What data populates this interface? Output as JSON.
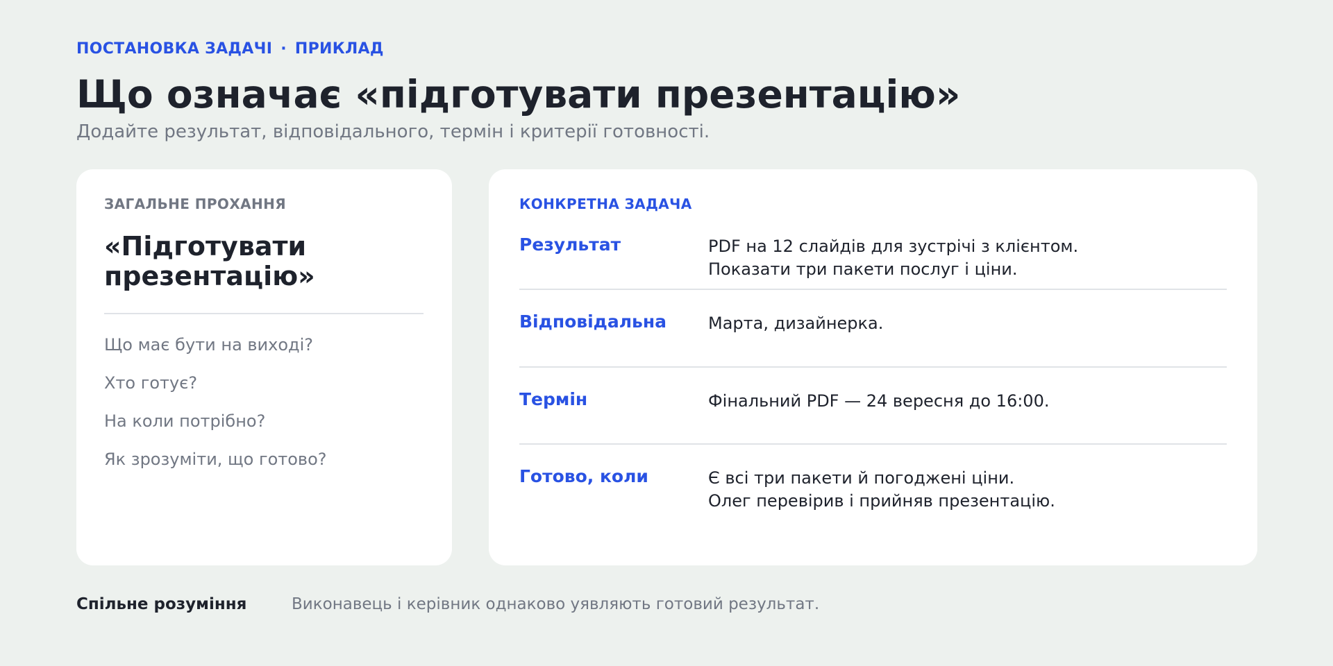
{
  "header": {
    "eyebrow_left": "ПОСТАНОВКА ЗАДАЧІ",
    "eyebrow_separator": "·",
    "eyebrow_right": "ПРИКЛАД",
    "title": "Що означає «підготувати презентацію»",
    "subtitle": "Додайте результат, відповідального, термін і критерії готовності."
  },
  "general": {
    "label": "ЗАГАЛЬНЕ ПРОХАННЯ",
    "quote_line1": "«Підготувати",
    "quote_line2": "презентацію»",
    "questions": [
      "Що має бути на виході?",
      "Хто готує?",
      "На коли потрібно?",
      "Як зрозуміти, що готово?"
    ]
  },
  "specific": {
    "label": "КОНКРЕТНА ЗАДАЧА",
    "rows": [
      {
        "key": "Результат",
        "line1": "PDF на 12 слайдів для зустрічі з клієнтом.",
        "line2": "Показати три пакети послуг і ціни."
      },
      {
        "key": "Відповідальна",
        "line1": "Марта, дизайнерка.",
        "line2": ""
      },
      {
        "key": "Термін",
        "line1": "Фінальний PDF — 24 вересня до 16:00.",
        "line2": ""
      },
      {
        "key": "Готово, коли",
        "line1": "Є всі три пакети й погоджені ціни.",
        "line2": "Олег перевірив і прийняв презентацію."
      }
    ]
  },
  "footer": {
    "key": "Спільне розуміння",
    "value": "Виконавець і керівник однаково уявляють готовий результат."
  },
  "colors": {
    "background": "#edf1ee",
    "accent": "#2952e3",
    "text": "#1e222c",
    "muted": "#717783",
    "card": "#ffffff"
  }
}
